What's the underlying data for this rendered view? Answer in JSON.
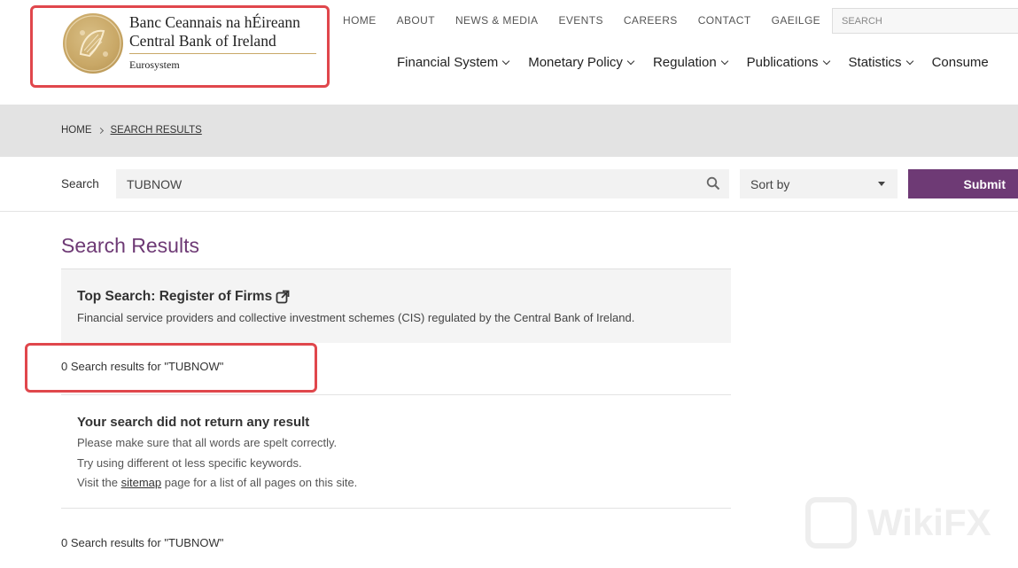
{
  "logo": {
    "line1": "Banc Ceannais na hÉireann",
    "line2": "Central Bank of Ireland",
    "line3": "Eurosystem"
  },
  "topnav": [
    "HOME",
    "ABOUT",
    "NEWS & MEDIA",
    "EVENTS",
    "CAREERS",
    "CONTACT",
    "GAEILGE"
  ],
  "header_search": {
    "placeholder": "SEARCH"
  },
  "mainnav": [
    "Financial System",
    "Monetary Policy",
    "Regulation",
    "Publications",
    "Statistics",
    "Consume"
  ],
  "breadcrumb": {
    "home": "HOME",
    "current": "SEARCH RESULTS"
  },
  "search": {
    "label": "Search",
    "value": "TUBNOW",
    "sort_label": "Sort by",
    "submit_label": "Submit"
  },
  "results": {
    "title": "Search Results",
    "top_search_title": "Top Search: Register of Firms",
    "top_search_desc": "Financial service providers and collective investment schemes (CIS) regulated by the Central Bank of Ireland.",
    "count_text": "0 Search results for \"TUBNOW\"",
    "no_result_title": "Your search did not return any result",
    "tip1": "Please make sure that all words are spelt correctly.",
    "tip2": "Try using different ot less specific keywords.",
    "tip3_before": "Visit the ",
    "tip3_link": "sitemap",
    "tip3_after": " page for a list of all pages on this site.",
    "count_text_bottom": "0 Search results for \"TUBNOW\""
  },
  "watermark": {
    "text": "WikiFX"
  },
  "colors": {
    "brand_purple": "#6e3a75",
    "highlight_red": "#e0474c",
    "seal_gold": "#c9a867"
  }
}
